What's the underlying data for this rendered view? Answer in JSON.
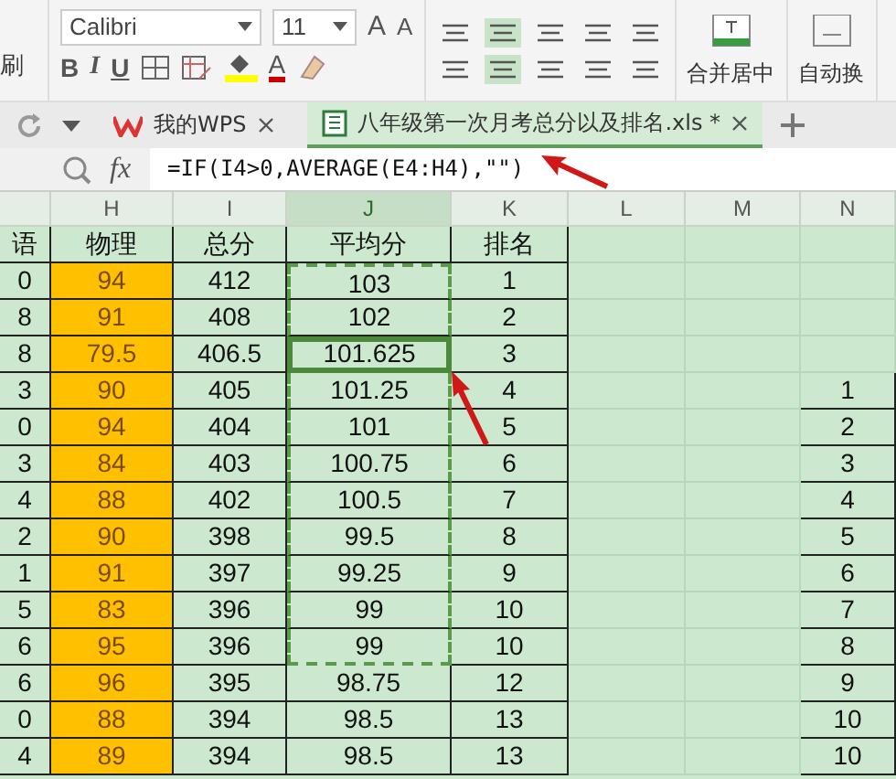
{
  "ribbon": {
    "cut_label": "刷",
    "font_name": "Calibri",
    "font_size": "11",
    "size_buttons": [
      "A",
      "A"
    ],
    "style_buttons": [
      "B",
      "I",
      "U"
    ],
    "font_color_button": "A",
    "merge_button": "合并居中",
    "wrap_button": "自动换"
  },
  "tabs": [
    {
      "label": "我的WPS",
      "kind": "home",
      "selected": false
    },
    {
      "label": "八年级第一次月考总分以及排名.xls *",
      "kind": "sheet",
      "selected": true
    }
  ],
  "formula_bar": {
    "fx": "fx",
    "formula": "=IF(I4>0,AVERAGE(E4:H4),\"\")"
  },
  "sheet": {
    "columns": [
      {
        "selected": false,
        "highlighted": false
      },
      {
        "letter": "H",
        "selected": false,
        "highlighted": true
      },
      {
        "letter": "I",
        "selected": false,
        "highlighted": false
      },
      {
        "letter": "J",
        "selected": true,
        "highlighted": false
      },
      {
        "letter": "K",
        "selected": false,
        "highlighted": false
      },
      {
        "letter": "L",
        "selected": false,
        "highlighted": false
      },
      {
        "letter": "M",
        "selected": false,
        "highlighted": false
      },
      {
        "letter": "N",
        "selected": false,
        "highlighted": false
      }
    ],
    "rows": [
      {
        "cells": [
          "语",
          "物理",
          "总分",
          "平均分",
          "排名",
          "",
          "",
          ""
        ],
        "active": false,
        "copy_range": false
      },
      {
        "cells": [
          "0",
          "94",
          "412",
          "103",
          "1",
          "",
          "",
          ""
        ],
        "active": false,
        "copy_range": true
      },
      {
        "cells": [
          "8",
          "91",
          "408",
          "102",
          "2",
          "",
          "",
          ""
        ],
        "active": false,
        "copy_range": true
      },
      {
        "cells": [
          "8",
          "79.5",
          "406.5",
          "101.625",
          "3",
          "",
          "",
          ""
        ],
        "active": true,
        "copy_range": true
      },
      {
        "cells": [
          "3",
          "90",
          "405",
          "101.25",
          "4",
          "",
          "",
          "1"
        ],
        "active": false,
        "copy_range": true
      },
      {
        "cells": [
          "0",
          "94",
          "404",
          "101",
          "5",
          "",
          "",
          "2"
        ],
        "active": false,
        "copy_range": true
      },
      {
        "cells": [
          "3",
          "84",
          "403",
          "100.75",
          "6",
          "",
          "",
          "3"
        ],
        "active": false,
        "copy_range": true
      },
      {
        "cells": [
          "4",
          "88",
          "402",
          "100.5",
          "7",
          "",
          "",
          "4"
        ],
        "active": false,
        "copy_range": true
      },
      {
        "cells": [
          "2",
          "90",
          "398",
          "99.5",
          "8",
          "",
          "",
          "5"
        ],
        "active": false,
        "copy_range": true
      },
      {
        "cells": [
          "1",
          "91",
          "397",
          "99.25",
          "9",
          "",
          "",
          "6"
        ],
        "active": false,
        "copy_range": true
      },
      {
        "cells": [
          "5",
          "83",
          "396",
          "99",
          "10",
          "",
          "",
          "7"
        ],
        "active": false,
        "copy_range": true
      },
      {
        "cells": [
          "6",
          "95",
          "396",
          "99",
          "10",
          "",
          "",
          "8"
        ],
        "active": false,
        "copy_range": true
      },
      {
        "cells": [
          "6",
          "96",
          "395",
          "98.75",
          "12",
          "",
          "",
          "9"
        ],
        "active": false,
        "copy_range": false
      },
      {
        "cells": [
          "0",
          "88",
          "394",
          "98.5",
          "13",
          "",
          "",
          "10"
        ],
        "active": false,
        "copy_range": false
      },
      {
        "cells": [
          "4",
          "89",
          "394",
          "98.5",
          "13",
          "",
          "",
          "10"
        ],
        "active": false,
        "copy_range": false
      }
    ]
  }
}
